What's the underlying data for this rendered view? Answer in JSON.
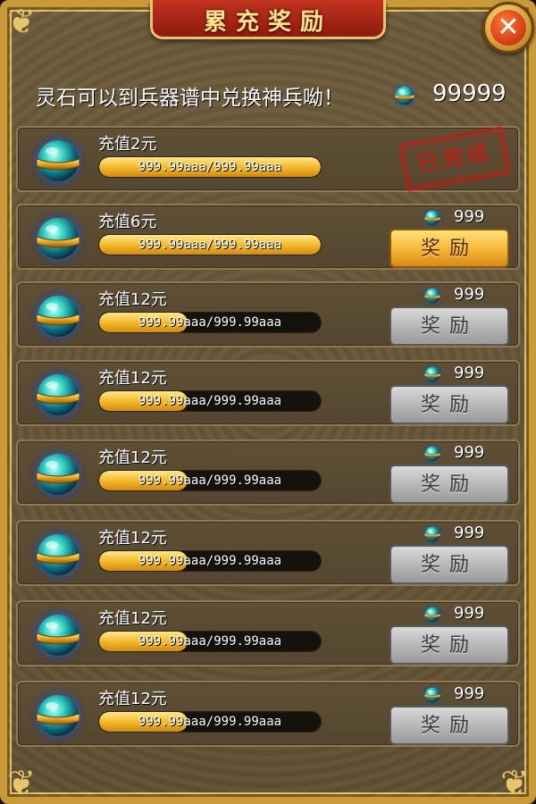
{
  "title": "累充奖励",
  "close_icon": "close-icon",
  "info": {
    "text": "灵石可以到兵器谱中兑换神兵呦！",
    "currency_icon": "spirit-stone-icon",
    "count": "99999"
  },
  "colors": {
    "frame_gold": "#c99a3a",
    "title_red": "#b02a16",
    "bar_gold": "#f2b526",
    "stamp_red": "#c21d12",
    "button_gold": "#f5b533",
    "button_gray": "#b5b5b5"
  },
  "rows": [
    {
      "label": "充值2元",
      "progress_text": "999.99aaa/999.99aaa",
      "progress": 1.0,
      "reward": "",
      "button": "",
      "status": "已完成",
      "state": "completed"
    },
    {
      "label": "充值6元",
      "progress_text": "999.99aaa/999.99aaa",
      "progress": 1.0,
      "reward": "999",
      "button": "奖励",
      "status": "",
      "state": "claimable"
    },
    {
      "label": "充值12元",
      "progress_text": "999.99aaa/999.99aaa",
      "progress": 0.4,
      "reward": "999",
      "button": "奖励",
      "status": "",
      "state": "locked"
    },
    {
      "label": "充值12元",
      "progress_text": "999.99aaa/999.99aaa",
      "progress": 0.4,
      "reward": "999",
      "button": "奖励",
      "status": "",
      "state": "locked"
    },
    {
      "label": "充值12元",
      "progress_text": "999.99aaa/999.99aaa",
      "progress": 0.4,
      "reward": "999",
      "button": "奖励",
      "status": "",
      "state": "locked"
    },
    {
      "label": "充值12元",
      "progress_text": "999.99aaa/999.99aaa",
      "progress": 0.4,
      "reward": "999",
      "button": "奖励",
      "status": "",
      "state": "locked"
    },
    {
      "label": "充值12元",
      "progress_text": "999.99aaa/999.99aaa",
      "progress": 0.4,
      "reward": "999",
      "button": "奖励",
      "status": "",
      "state": "locked"
    },
    {
      "label": "充值12元",
      "progress_text": "999.99aaa/999.99aaa",
      "progress": 0.4,
      "reward": "999",
      "button": "奖励",
      "status": "",
      "state": "locked"
    }
  ]
}
